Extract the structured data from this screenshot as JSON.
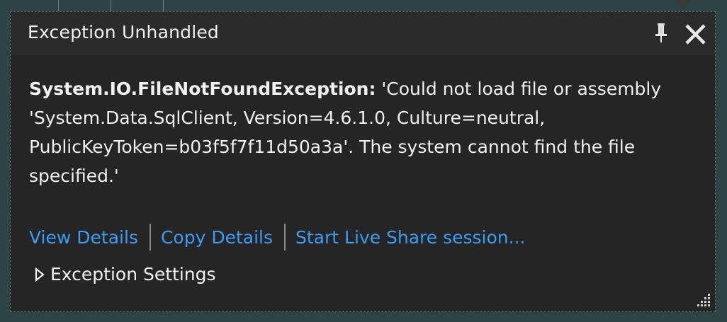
{
  "popup": {
    "title": "Exception Unhandled",
    "exception_type": "System.IO.FileNotFoundException:",
    "exception_message": "'Could not load file or assembly 'System.Data.SqlClient, Version=4.6.1.0, Culture=neutral, PublicKeyToken=b03f5f7f11d50a3a'. The system cannot find the file specified.'"
  },
  "links": {
    "view_details": "View Details",
    "copy_details": "Copy Details",
    "live_share": "Start Live Share session..."
  },
  "settings": {
    "label": "Exception Settings",
    "expanded": false
  },
  "icons": {
    "pin": "pin-icon",
    "close": "close-icon",
    "expand": "triangle-right-icon",
    "grip": "resize-grip-icon"
  },
  "colors": {
    "background": "#2d4447",
    "popup_bg": "#252526",
    "titlebar_bg": "#2b2b2c",
    "text": "#f1f1f1",
    "link": "#3a9bf2"
  }
}
